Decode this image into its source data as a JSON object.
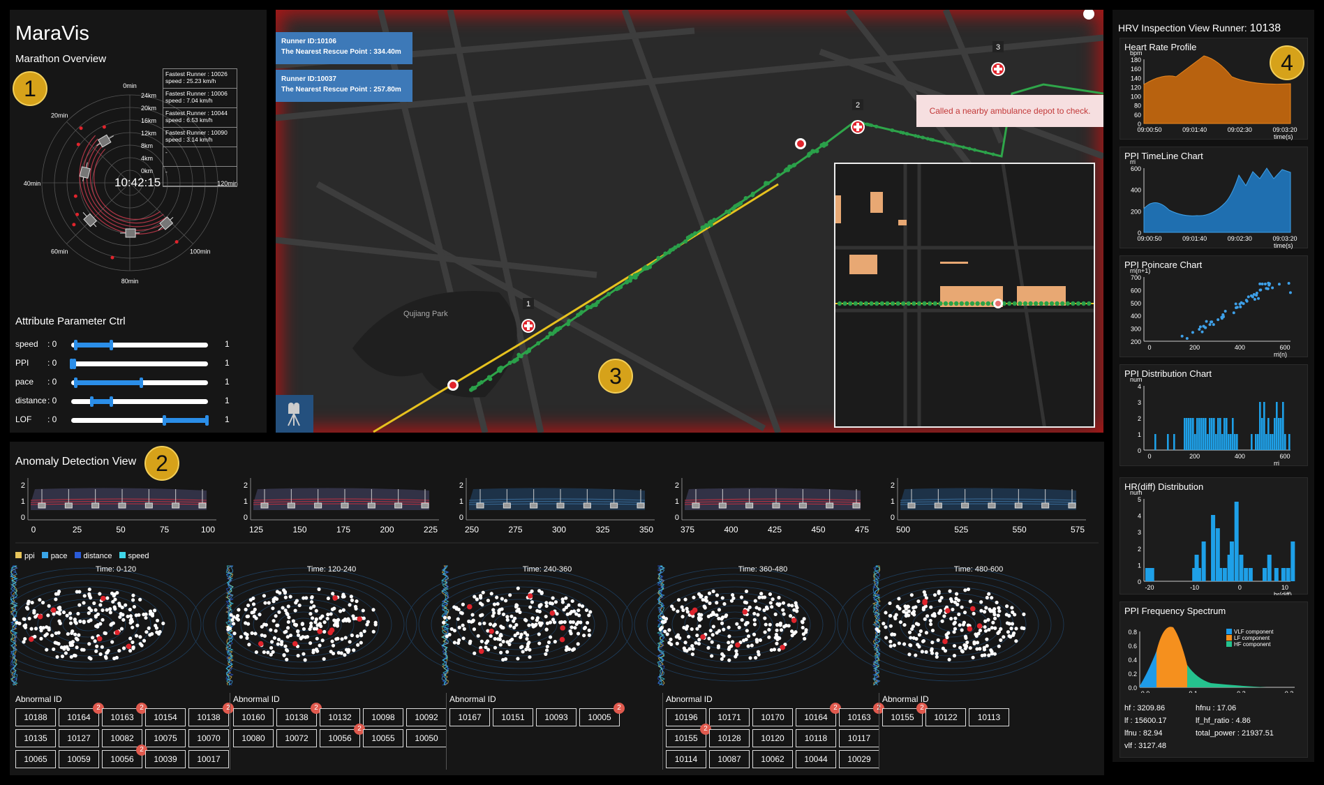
{
  "overview": {
    "title": "MaraVis",
    "subtitle": "Marathon Overview",
    "marker": "1",
    "clock": "10:42:15",
    "time_labels": [
      "0min",
      "20min",
      "40min",
      "60min",
      "80min",
      "100min",
      "120min"
    ],
    "dist_labels": [
      "24km",
      "20km",
      "16km",
      "12km",
      "8km",
      "4km",
      "0km"
    ],
    "fastest": [
      {
        "line1": "Fastest Runner : 10026",
        "line2": "speed : 25.23 km/h"
      },
      {
        "line1": "Fastest Runner : 10006",
        "line2": "speed : 7.04 km/h"
      },
      {
        "line1": "Fastest Runner : 10044",
        "line2": "speed : 6.53 km/h"
      },
      {
        "line1": "Fastest Runner : 10090",
        "line2": "speed : 3.14 km/h"
      },
      {
        "line1": "-",
        "line2": ""
      },
      {
        "line1": "-",
        "line2": ""
      }
    ],
    "ctrl_title": "Attribute Parameter Ctrl",
    "sliders": [
      {
        "label": "speed",
        "min": "0",
        "max": "1",
        "lo": 0.03,
        "hi": 0.3
      },
      {
        "label": "PPI",
        "min": "0",
        "max": "1",
        "lo": 0.0,
        "hi": 0.03
      },
      {
        "label": "pace",
        "min": "0",
        "max": "1",
        "lo": 0.03,
        "hi": 0.52
      },
      {
        "label": "distance",
        "min": "0",
        "max": "1",
        "lo": 0.15,
        "hi": 0.3
      },
      {
        "label": "LOF",
        "min": "0",
        "max": "1",
        "lo": 0.68,
        "hi": 1.0
      }
    ]
  },
  "map": {
    "marker": "3",
    "tooltips": [
      {
        "line1": "Runner ID:10106",
        "line2": "The Nearest Rescue Point : 334.40m"
      },
      {
        "line1": "Runner ID:10037",
        "line2": "The Nearest Rescue Point : 257.80m"
      }
    ],
    "alert": "Called a nearby ambulance depot to check.",
    "park_label": "Qujiang Park",
    "rescue_points": [
      "1",
      "2",
      "3"
    ],
    "camera_icon": "camera-icon"
  },
  "anomaly": {
    "title": "Anomaly Detection View",
    "marker": "2",
    "ticks": [
      [
        "0",
        "25",
        "50",
        "75",
        "100"
      ],
      [
        "125",
        "150",
        "175",
        "200",
        "225"
      ],
      [
        "250",
        "275",
        "300",
        "325",
        "350"
      ],
      [
        "375",
        "400",
        "425",
        "450",
        "475"
      ],
      [
        "500",
        "525",
        "550",
        "575"
      ]
    ],
    "y_ticks": [
      "2",
      "1",
      "0"
    ],
    "legend": [
      {
        "label": "ppi",
        "color": "#e8c55a"
      },
      {
        "label": "pace",
        "color": "#3aa6e8"
      },
      {
        "label": "distance",
        "color": "#2a5bd8"
      },
      {
        "label": "speed",
        "color": "#3fd5e8"
      }
    ],
    "windows": [
      "Time: 0-120",
      "Time: 120-240",
      "Time: 240-360",
      "Time: 360-480",
      "Time: 480-600"
    ],
    "abnormal_label": "Abnormal ID",
    "groups": [
      [
        [
          {
            "id": "10188"
          },
          {
            "id": "10164",
            "b": "2"
          },
          {
            "id": "10163",
            "b": "2"
          },
          {
            "id": "10154"
          },
          {
            "id": "10138",
            "b": "2"
          }
        ],
        [
          {
            "id": "10135"
          },
          {
            "id": "10127"
          },
          {
            "id": "10082"
          },
          {
            "id": "10075"
          },
          {
            "id": "10070"
          }
        ],
        [
          {
            "id": "10065"
          },
          {
            "id": "10059"
          },
          {
            "id": "10056",
            "b": "2"
          },
          {
            "id": "10039"
          },
          {
            "id": "10017"
          }
        ]
      ],
      [
        [
          {
            "id": "10160"
          },
          {
            "id": "10138",
            "b": "2"
          },
          {
            "id": "10132"
          },
          {
            "id": "10098"
          },
          {
            "id": "10092"
          }
        ],
        [
          {
            "id": "10080"
          },
          {
            "id": "10072"
          },
          {
            "id": "10056",
            "b": "2"
          },
          {
            "id": "10055"
          },
          {
            "id": "10050"
          }
        ]
      ],
      [
        [
          {
            "id": "10167"
          },
          {
            "id": "10151"
          },
          {
            "id": "10093"
          },
          {
            "id": "10005",
            "b": "2"
          }
        ]
      ],
      [
        [
          {
            "id": "10196"
          },
          {
            "id": "10171"
          },
          {
            "id": "10170"
          },
          {
            "id": "10164",
            "b": "2"
          },
          {
            "id": "10163",
            "b": "2"
          }
        ],
        [
          {
            "id": "10155",
            "b": "2"
          },
          {
            "id": "10128"
          },
          {
            "id": "10120"
          },
          {
            "id": "10118"
          },
          {
            "id": "10117"
          }
        ],
        [
          {
            "id": "10114"
          },
          {
            "id": "10087"
          },
          {
            "id": "10062"
          },
          {
            "id": "10044"
          },
          {
            "id": "10029"
          }
        ]
      ],
      [
        [
          {
            "id": "10155",
            "b": "2"
          },
          {
            "id": "10122"
          },
          {
            "id": "10113"
          }
        ]
      ]
    ]
  },
  "hrv": {
    "title": "HRV Inspection View Runner:",
    "runner": "10138",
    "marker": "4",
    "hr": {
      "title": "Heart Rate Profile",
      "unit": "bpm",
      "y": [
        "180",
        "160",
        "140",
        "120",
        "100",
        "80",
        "60",
        "0"
      ],
      "x": [
        "09:00:50",
        "09:01:40",
        "09:02:30",
        "09:03:20"
      ],
      "xunit": "time(s)"
    },
    "ppi_tl": {
      "title": "PPI TimeLine Chart",
      "unit": "rri",
      "y": [
        "600",
        "400",
        "200",
        "0"
      ],
      "x": [
        "09:00:50",
        "09:01:40",
        "09:02:30",
        "09:03:20"
      ],
      "xunit": "time(s)"
    },
    "poincare": {
      "title": "PPI Poincare Chart",
      "unit": "rri(n+1)",
      "y": [
        "700",
        "600",
        "500",
        "400",
        "300",
        "200"
      ],
      "x": [
        "0",
        "200",
        "400",
        "600"
      ],
      "xunit": "rri(n)"
    },
    "dist": {
      "title": "PPI Distribution Chart",
      "unit": "num",
      "y": [
        "4",
        "3",
        "2",
        "1",
        "0"
      ],
      "x": [
        "0",
        "200",
        "400",
        "600"
      ],
      "xunit": "rri"
    },
    "hrdiff": {
      "title": "HR(diff) Distribution",
      "unit": "num",
      "y": [
        "5",
        "4",
        "3",
        "2",
        "1",
        "0"
      ],
      "x": [
        "-20",
        "-10",
        "0",
        "10"
      ],
      "xunit": "hr(diff)"
    },
    "spectrum": {
      "title": "PPI Frequency Spectrum",
      "y": [
        "0.8",
        "0.6",
        "0.4",
        "0.2",
        "0.0"
      ],
      "x": [
        "0.0",
        "0.1",
        "0.2",
        "0.3"
      ],
      "legend": [
        {
          "label": "VLF component",
          "color": "#1e9be8"
        },
        {
          "label": "LF component",
          "color": "#f5901e"
        },
        {
          "label": "HF component",
          "color": "#25c28e"
        }
      ]
    },
    "stats": [
      {
        "k": "hf",
        "v": "3209.86"
      },
      {
        "k": "hfnu",
        "v": "17.06"
      },
      {
        "k": "lf",
        "v": "15600.17"
      },
      {
        "k": "lf_hf_ratio",
        "v": "4.86"
      },
      {
        "k": "lfnu",
        "v": "82.94"
      },
      {
        "k": "total_power",
        "v": "21937.51"
      },
      {
        "k": "vlf",
        "v": "3127.48"
      }
    ]
  }
}
